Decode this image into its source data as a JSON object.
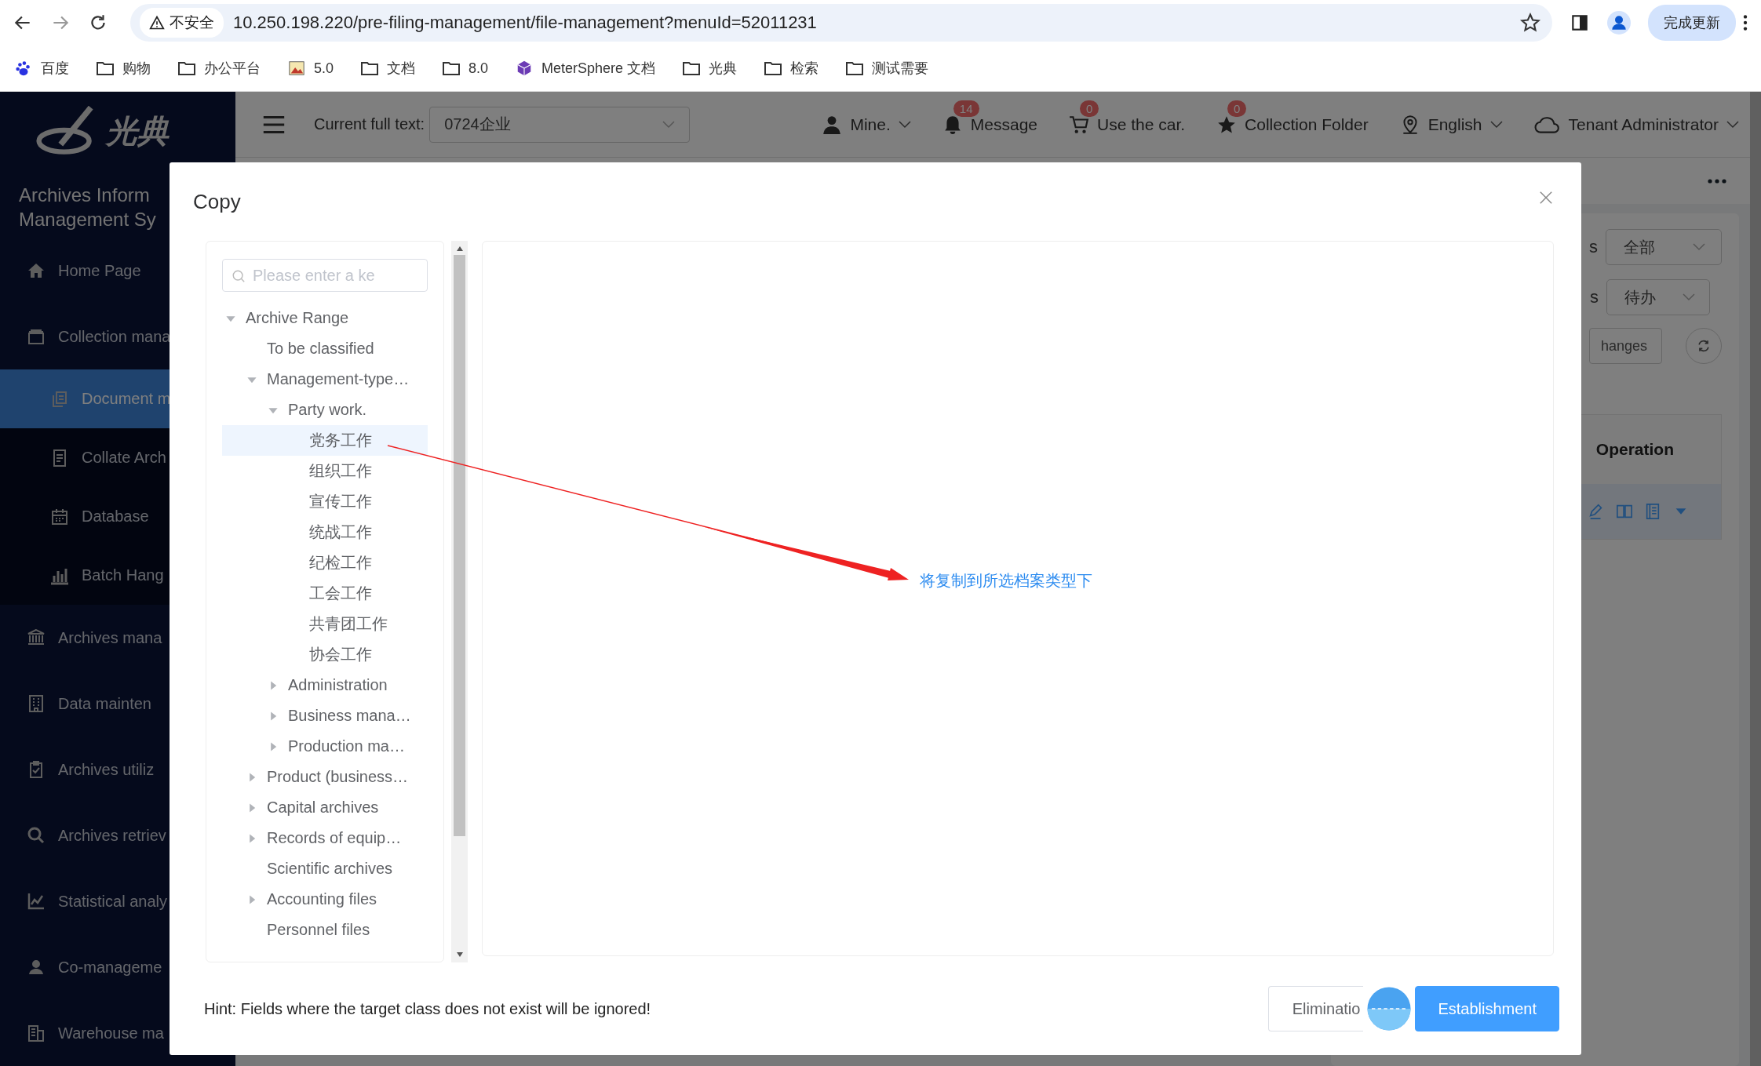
{
  "browser": {
    "security_label": "不安全",
    "url": "10.250.198.220/pre-filing-management/file-management?menuId=52011231",
    "update_button": "完成更新"
  },
  "bookmarks": [
    {
      "label": "百度",
      "kind": "paw"
    },
    {
      "label": "购物",
      "kind": "folder"
    },
    {
      "label": "办公平台",
      "kind": "folder"
    },
    {
      "label": "5.0",
      "kind": "image"
    },
    {
      "label": "文档",
      "kind": "folder"
    },
    {
      "label": "8.0",
      "kind": "folder"
    },
    {
      "label": "MeterSphere 文档",
      "kind": "cube"
    },
    {
      "label": "光典",
      "kind": "folder"
    },
    {
      "label": "检索",
      "kind": "folder"
    },
    {
      "label": "测试需要",
      "kind": "folder"
    }
  ],
  "sidebar": {
    "logo_text": "光典",
    "title_lines": [
      "Archives Inform",
      "Management Sy"
    ],
    "items": [
      {
        "label": "Home Page",
        "kind": "home",
        "selected": false
      },
      {
        "label": "Collection mana",
        "kind": "tray",
        "selected": false,
        "expanded": true,
        "children": [
          {
            "label": "Document m",
            "kind": "copy",
            "selected": true
          },
          {
            "label": "Collate Arch",
            "kind": "doc",
            "selected": false
          },
          {
            "label": "Database",
            "kind": "calendar",
            "selected": false
          },
          {
            "label": "Batch Hang",
            "kind": "bars",
            "selected": false
          }
        ]
      },
      {
        "label": "Archives mana",
        "kind": "bank",
        "selected": false
      },
      {
        "label": "Data mainten",
        "kind": "building",
        "selected": false
      },
      {
        "label": "Archives utiliz",
        "kind": "clipboard",
        "selected": false
      },
      {
        "label": "Archives retriev",
        "kind": "search",
        "selected": false
      },
      {
        "label": "Statistical analy",
        "kind": "linechart",
        "selected": false
      },
      {
        "label": "Co-manageme",
        "kind": "user",
        "selected": false
      },
      {
        "label": "Warehouse ma",
        "kind": "office",
        "selected": false
      }
    ]
  },
  "header": {
    "full_text_label": "Current full text:",
    "full_text_value": "0724企业",
    "user": "Mine.",
    "message": {
      "label": "Message",
      "count": "14"
    },
    "cart": {
      "label": "Use the car.",
      "count": "0"
    },
    "favorites": {
      "label": "Collection Folder",
      "count": "0"
    },
    "language": "English",
    "role": "Tenant Administrator"
  },
  "background": {
    "filters": [
      {
        "label": "s",
        "value": "全部"
      },
      {
        "label": "s",
        "value": "待办"
      }
    ],
    "changes_button": "hanges",
    "table": {
      "columns": [
        "Operation"
      ]
    }
  },
  "dialog": {
    "title": "Copy",
    "search": {
      "placeholder": "Please enter a ke"
    },
    "tree": [
      {
        "label": "Archive Range",
        "expanded": true,
        "selected": false,
        "children": [
          {
            "label": "To be classified",
            "selected": false
          },
          {
            "label": "Management-type…",
            "expanded": true,
            "selected": false,
            "children": [
              {
                "label": "Party work.",
                "expanded": true,
                "selected": false,
                "children": [
                  {
                    "label": "党务工作",
                    "selected": true
                  },
                  {
                    "label": "组织工作",
                    "selected": false
                  },
                  {
                    "label": "宣传工作",
                    "selected": false
                  },
                  {
                    "label": "统战工作",
                    "selected": false
                  },
                  {
                    "label": "纪检工作",
                    "selected": false
                  },
                  {
                    "label": "工会工作",
                    "selected": false
                  },
                  {
                    "label": "共青团工作",
                    "selected": false
                  },
                  {
                    "label": "协会工作",
                    "selected": false
                  }
                ]
              },
              {
                "label": "Administration",
                "expanded": false,
                "selected": false
              },
              {
                "label": "Business mana…",
                "expanded": false,
                "selected": false
              },
              {
                "label": "Production ma…",
                "expanded": false,
                "selected": false
              }
            ]
          },
          {
            "label": "Product (business…",
            "expanded": false,
            "selected": false
          },
          {
            "label": "Capital archives",
            "expanded": false,
            "selected": false
          },
          {
            "label": "Records of equip…",
            "expanded": false,
            "selected": false
          },
          {
            "label": "Scientific archives",
            "selected": false
          },
          {
            "label": "Accounting files",
            "expanded": false,
            "selected": false
          },
          {
            "label": "Personnel files",
            "selected": false
          }
        ]
      }
    ],
    "annotation": "将复制到所选档案类型下",
    "hint": "Hint: Fields where the target class does not exist will be ignored!",
    "buttons": [
      {
        "label": "Eliminatio",
        "kind": "secondary"
      },
      {
        "label": "Establishment",
        "kind": "primary"
      }
    ]
  }
}
